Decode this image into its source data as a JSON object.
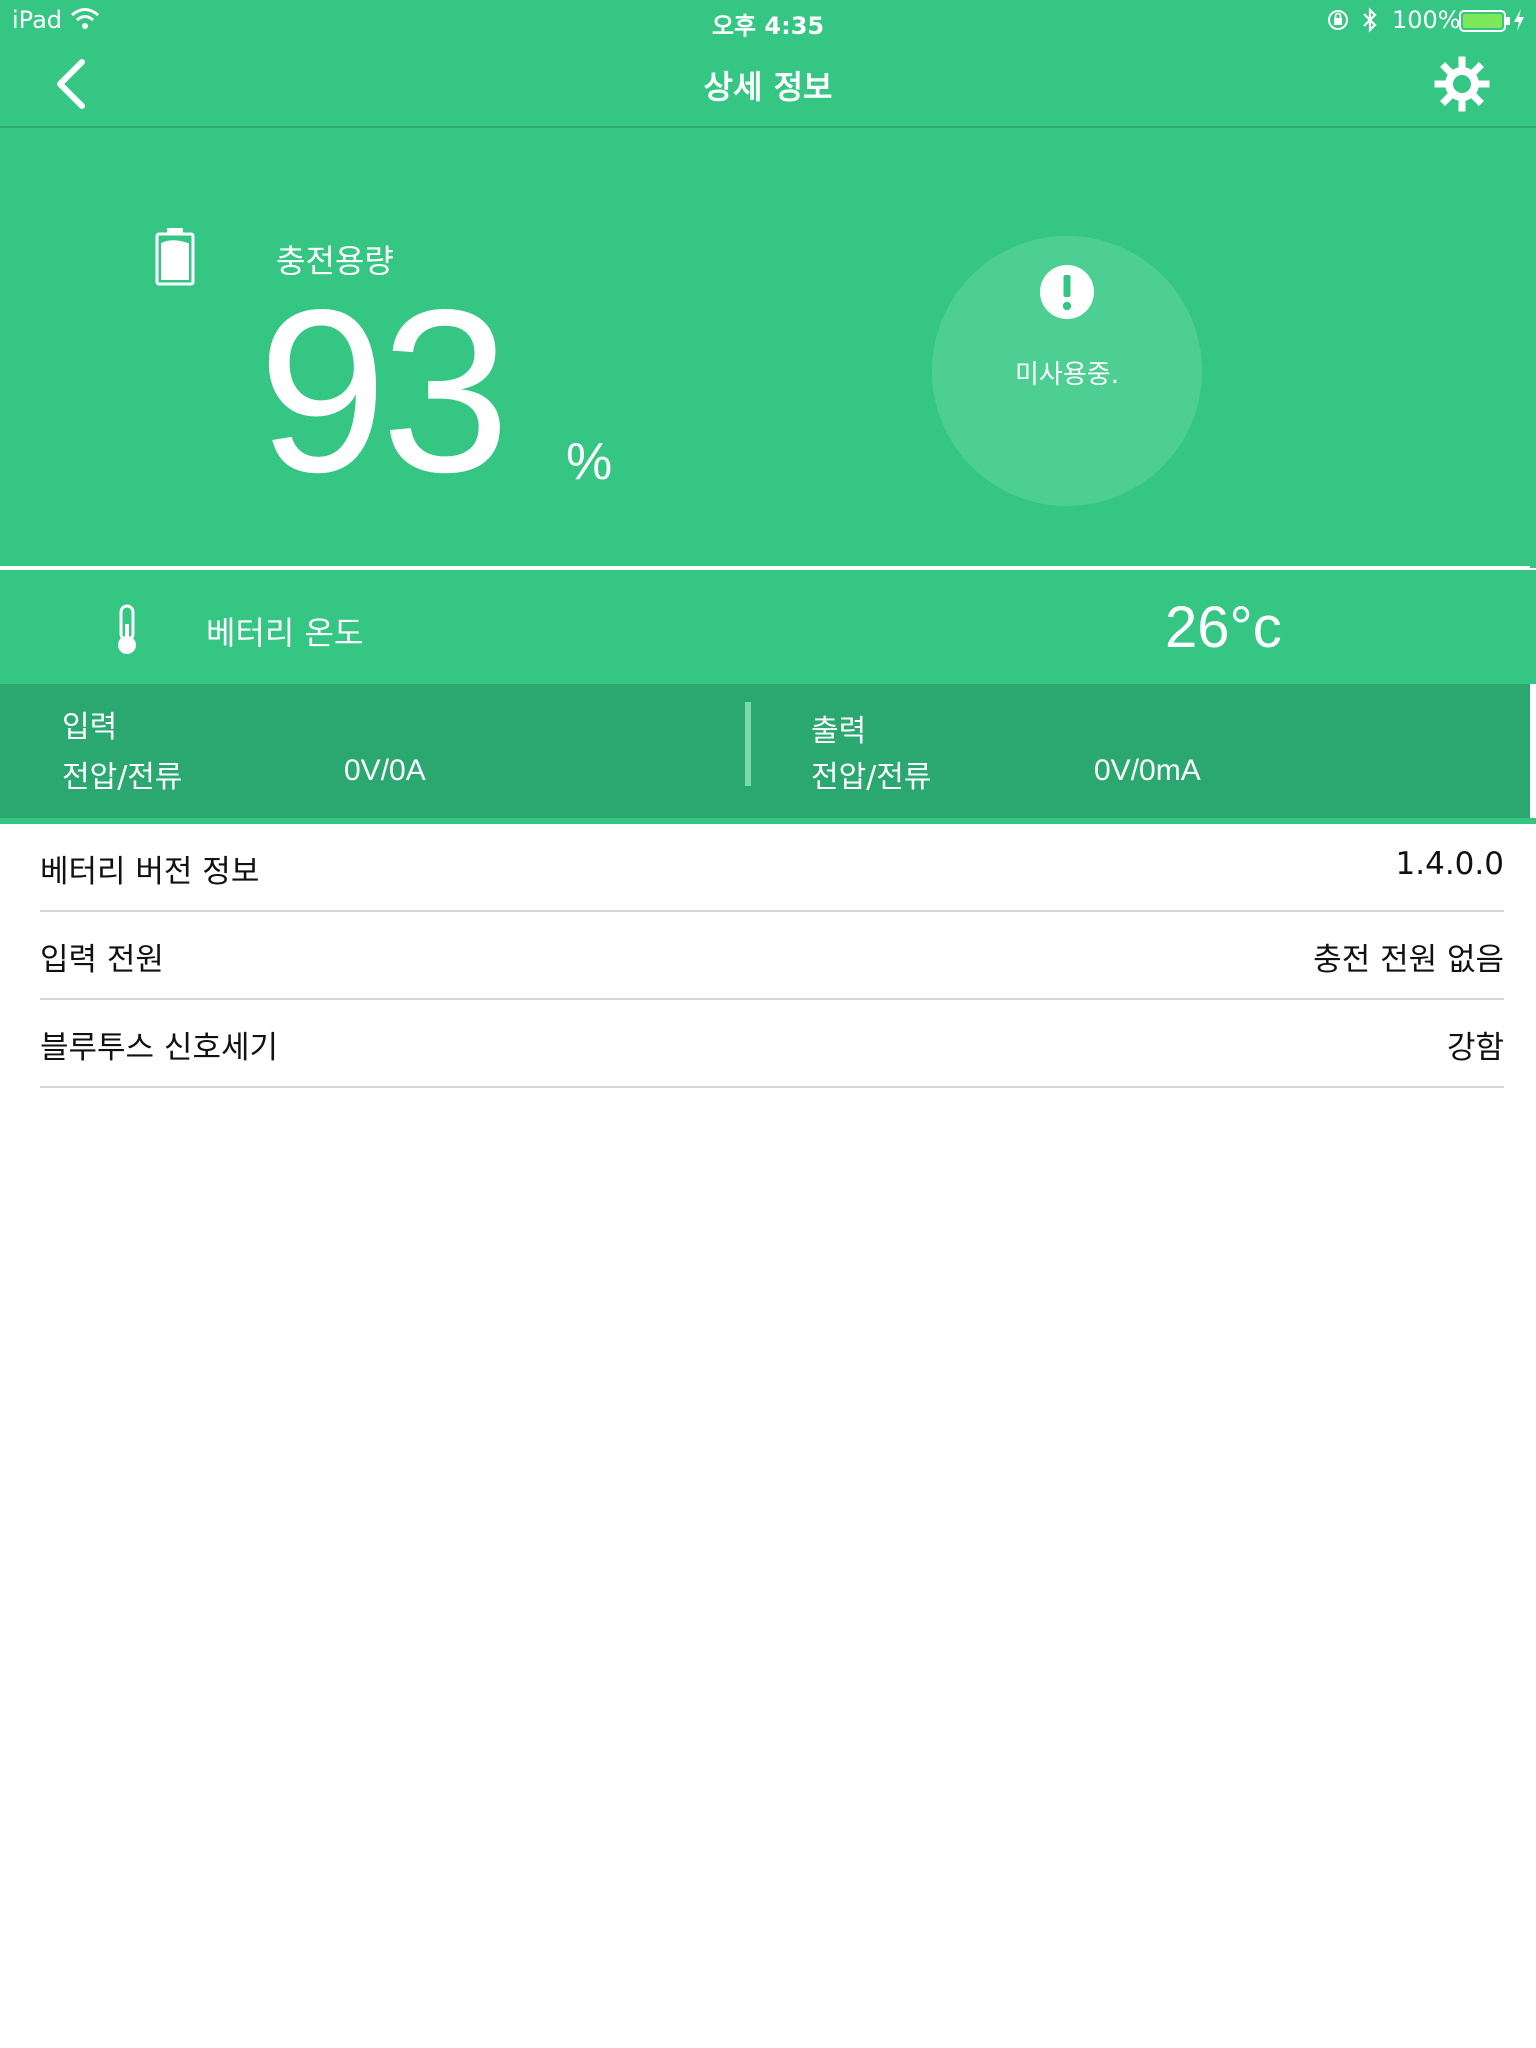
{
  "status_bar": {
    "device": "iPad",
    "time": "오후 4:35",
    "battery_percent": "100%"
  },
  "nav": {
    "title": "상세 정보",
    "back_icon": "chevron-left-icon",
    "settings_icon": "gear-icon"
  },
  "capacity": {
    "label": "충전용량",
    "value": "93",
    "unit": "%",
    "level": 93
  },
  "status_circle": {
    "icon": "alert-icon",
    "text": "미사용중."
  },
  "temperature": {
    "label": "베터리 온도",
    "value": "26°c"
  },
  "io": {
    "input": {
      "title": "입력",
      "label": "전압/전류",
      "value": "0V/0A"
    },
    "output": {
      "title": "출력",
      "label": "전압/전류",
      "value": "0V/0mA"
    }
  },
  "info": [
    {
      "label": "베터리 버전 정보",
      "value": "1.4.0.0"
    },
    {
      "label": "입력 전원",
      "value": "충전 전원 없음"
    },
    {
      "label": "블루투스 신호세기",
      "value": "강함"
    }
  ],
  "colors": {
    "primary": "#35c684",
    "panel": "#2aa86f",
    "circle": "#4dcf93",
    "divider": "#d6d6d6"
  }
}
